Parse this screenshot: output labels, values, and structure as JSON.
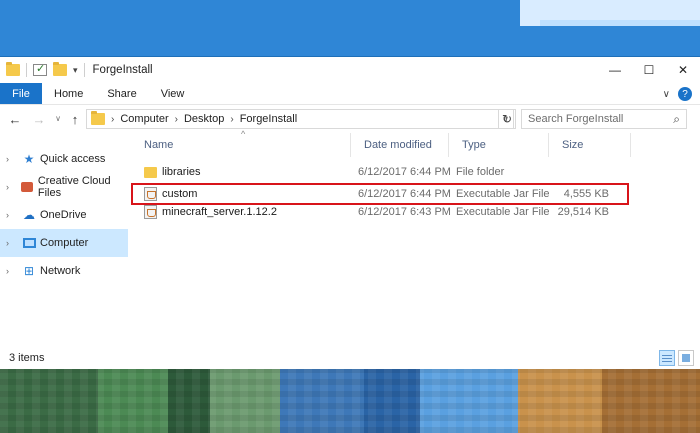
{
  "window": {
    "title": "ForgeInstall"
  },
  "ribbon": {
    "tabs": [
      "File",
      "Home",
      "Share",
      "View"
    ]
  },
  "address": {
    "crumbs": [
      "Computer",
      "Desktop",
      "ForgeInstall"
    ]
  },
  "search": {
    "placeholder": "Search ForgeInstall"
  },
  "navpane": {
    "items": [
      {
        "label": "Quick access",
        "icon": "star-icon"
      },
      {
        "label": "Creative Cloud Files",
        "icon": "creative-cloud-icon"
      },
      {
        "label": "OneDrive",
        "icon": "cloud-icon"
      },
      {
        "label": "Computer",
        "icon": "computer-icon",
        "selected": true
      },
      {
        "label": "Network",
        "icon": "network-icon"
      }
    ]
  },
  "columns": {
    "name": "Name",
    "date": "Date modified",
    "type": "Type",
    "size": "Size"
  },
  "files": [
    {
      "name": "libraries",
      "date": "6/12/2017 6:44 PM",
      "type": "File folder",
      "size": "",
      "icon": "folder-icon"
    },
    {
      "name": "custom",
      "date": "6/12/2017 6:44 PM",
      "type": "Executable Jar File",
      "size": "4,555 KB",
      "icon": "jar-file-icon",
      "highlighted": true
    },
    {
      "name": "minecraft_server.1.12.2",
      "date": "6/12/2017 6:43 PM",
      "type": "Executable Jar File",
      "size": "29,514 KB",
      "icon": "jar-file-icon"
    }
  ],
  "status": {
    "item_count": "3 items"
  },
  "colors": {
    "accent": "#1a73c9",
    "highlight_box": "#d8141a",
    "selected_bg": "#cce8ff"
  }
}
